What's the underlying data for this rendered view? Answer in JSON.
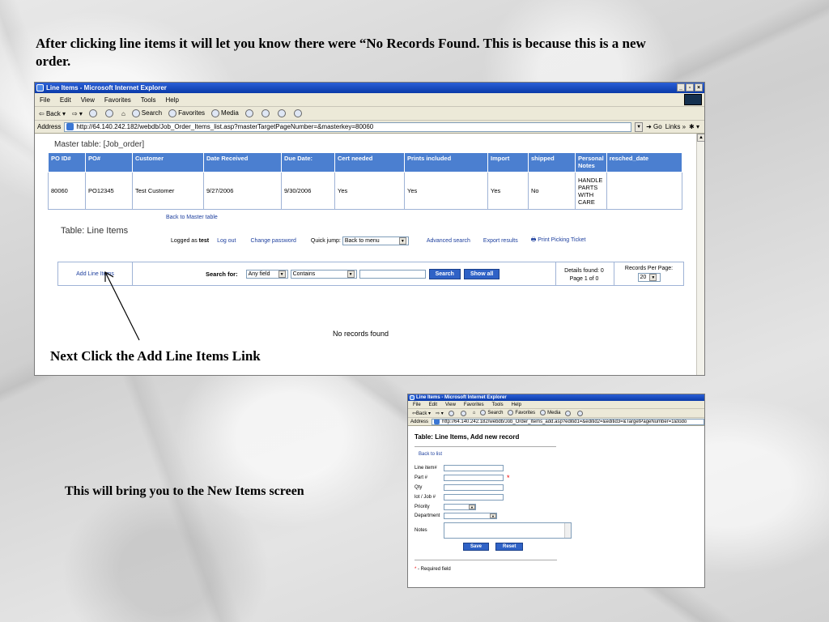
{
  "captions": {
    "top": "After clicking line items it will let you know there were “No Records Found. This is because this is a new order.",
    "middle": "Next Click the Add Line Items Link",
    "bottom": "This will bring you to the New Items screen"
  },
  "browser1": {
    "title": "Line Items - Microsoft Internet Explorer",
    "menu": [
      "File",
      "Edit",
      "View",
      "Favorites",
      "Tools",
      "Help"
    ],
    "toolbar": {
      "back": "Back",
      "search": "Search",
      "favorites": "Favorites",
      "media": "Media"
    },
    "address_label": "Address",
    "url": "http://64.140.242.182/webdb/Job_Order_Items_list.asp?masterTargetPageNumber=&masterkey=80060",
    "go": "Go",
    "links": "Links"
  },
  "master": {
    "title": "Master table: [Job_order]",
    "headers": [
      "PO ID#",
      "PO#",
      "Customer",
      "Date Received",
      "Due Date:",
      "Cert needed",
      "Prints included",
      "Import",
      "shipped",
      "Personal Notes",
      "resched_date"
    ],
    "row": [
      "80060",
      "PO12345",
      "Test Customer",
      "9/27/2006",
      "9/30/2006",
      "Yes",
      "Yes",
      "Yes",
      "No",
      "HANDLE PARTS WITH CARE",
      ""
    ]
  },
  "line_items": {
    "back_to_master": "Back to Master table",
    "title": "Table: Line Items",
    "logged_as": "Logged as",
    "user": "test",
    "logout": "Log out",
    "change_password": "Change password",
    "quick_jump": "Quick jump:",
    "quick_jump_value": "Back to menu",
    "advanced_search": "Advanced search",
    "export_results": "Export results",
    "print_picking": "Print Picking Ticket"
  },
  "search": {
    "add_link": "Add Line Items",
    "label": "Search for:",
    "field": "Any field",
    "mode": "Contains",
    "search_btn": "Search",
    "show_all_btn": "Show all",
    "details_found": "Details found: 0",
    "page_of": "Page 1 of 0",
    "records_per_page": "Records Per Page:",
    "rpp_value": "20"
  },
  "no_records": "No records found",
  "browser2": {
    "title": "Line Items - Microsoft Internet Explorer",
    "menu": [
      "File",
      "Edit",
      "View",
      "Favorites",
      "Tools",
      "Help"
    ],
    "toolbar": {
      "back": "Back",
      "search": "Search",
      "favorites": "Favorites",
      "media": "Media"
    },
    "address_label": "Address",
    "url": "http://64.140.242.182/webdb/Job_Order_Items_add.asp?editid1=&editid2=&editid3=&TargetPageNumber=1&todo"
  },
  "add_form": {
    "title": "Table: Line Items, Add new record",
    "back_to_list": "Back to list",
    "fields": [
      "Line item#",
      "Part #",
      "Qty",
      "lot / Job #",
      "Priority",
      "Department",
      "Notes"
    ],
    "required_mark": "*",
    "save": "Save",
    "reset": "Reset",
    "required_note": "- Required field"
  }
}
